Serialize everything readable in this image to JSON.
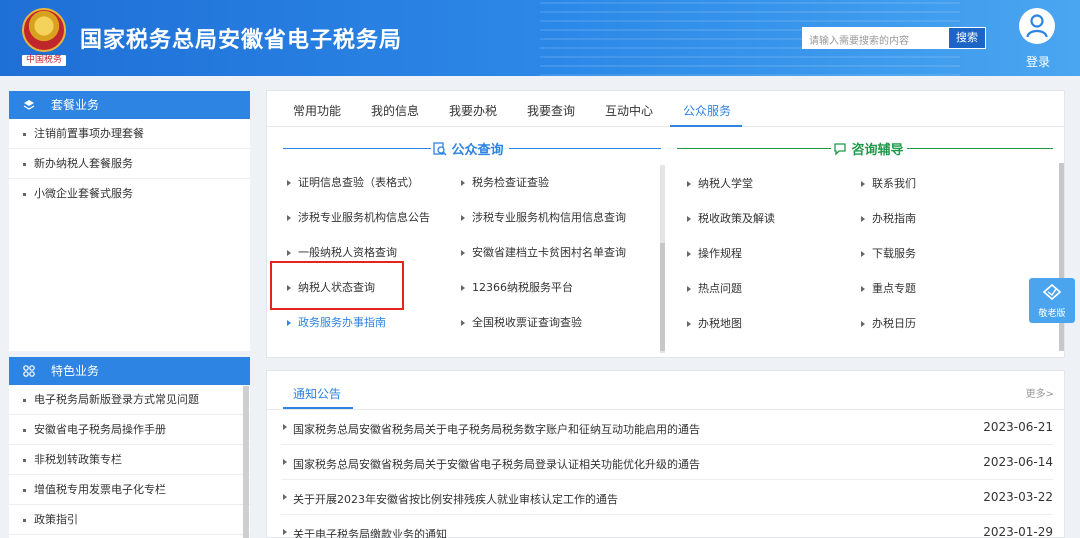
{
  "header": {
    "emblem_text": "中国税务",
    "title": "国家税务总局安徽省电子税务局",
    "search_placeholder": "请输入需要搜索的内容",
    "search_button": "搜索",
    "login_label": "登录"
  },
  "sidebar": {
    "package": {
      "title": "套餐业务",
      "items": [
        "注销前置事项办理套餐",
        "新办纳税人套餐服务",
        "小微企业套餐式服务"
      ]
    },
    "featured": {
      "title": "特色业务",
      "items": [
        "电子税务局新版登录方式常见问题",
        "安徽省电子税务局操作手册",
        "非税划转政策专栏",
        "增值税专用发票电子化专栏",
        "政策指引"
      ]
    }
  },
  "tabs": [
    "常用功能",
    "我的信息",
    "我要办税",
    "我要查询",
    "互动中心",
    "公众服务"
  ],
  "active_tab": "公众服务",
  "public_query": {
    "title": "公众查询",
    "col1": [
      "证明信息查验（表格式）",
      "涉税专业服务机构信息公告",
      "一般纳税人资格查询",
      "纳税人状态查询",
      "政务服务办事指南"
    ],
    "col2": [
      "税务检查证查验",
      "涉税专业服务机构信用信息查询",
      "安徽省建档立卡贫困村名单查询",
      "12366纳税服务平台",
      "全国税收票证查询查验"
    ]
  },
  "consult": {
    "title": "咨询辅导",
    "col1": [
      "纳税人学堂",
      "税收政策及解读",
      "操作规程",
      "热点问题",
      "办税地图"
    ],
    "col2": [
      "联系我们",
      "办税指南",
      "下载服务",
      "重点专题",
      "办税日历"
    ]
  },
  "elder_mode": "敬老版",
  "notice": {
    "tab": "通知公告",
    "more": "更多>",
    "rows": [
      {
        "title": "国家税务总局安徽省税务局关于电子税务局税务数字账户和征纳互动功能启用的通告",
        "date": "2023-06-21"
      },
      {
        "title": "国家税务总局安徽省税务局关于安徽省电子税务局登录认证相关功能优化升级的通告",
        "date": "2023-06-14"
      },
      {
        "title": "关于开展2023年安徽省按比例安排残疾人就业审核认定工作的通告",
        "date": "2023-03-22"
      },
      {
        "title": "关于电子税务局缴款业务的通知",
        "date": "2023-01-29"
      }
    ]
  }
}
